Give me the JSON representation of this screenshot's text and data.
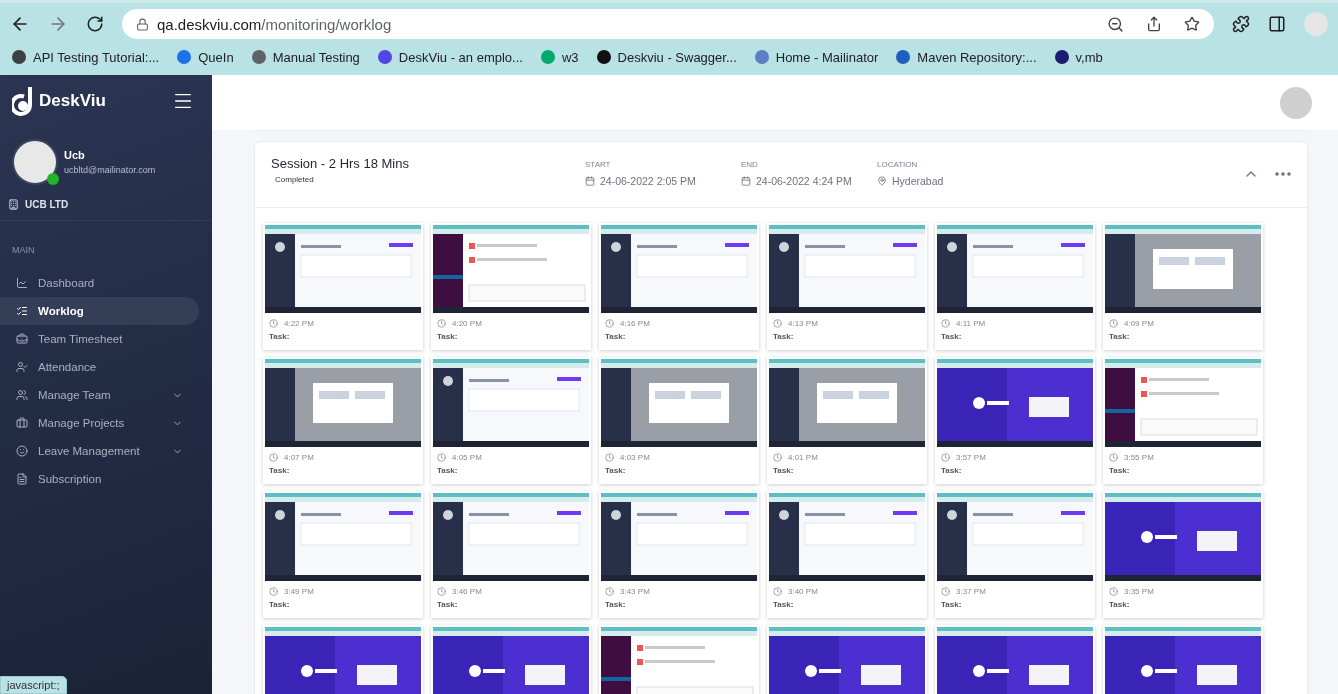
{
  "browser": {
    "url_host": "qa.deskviu.com",
    "url_path": "/monitoring/worklog",
    "bookmarks": [
      {
        "label": "API Testing Tutorial:...",
        "color": "#3c4043"
      },
      {
        "label": "QueIn",
        "color": "#1a73e8"
      },
      {
        "label": "Manual Testing",
        "color": "#5f6368"
      },
      {
        "label": "DeskViu - an emplo...",
        "color": "#4f46e5"
      },
      {
        "label": "w3",
        "color": "#04aa6d"
      },
      {
        "label": "Deskviu - Swagger...",
        "color": "#111111"
      },
      {
        "label": "Home - Mailinator",
        "color": "#5b7fc4"
      },
      {
        "label": "Maven Repository:...",
        "color": "#1f5fbf"
      },
      {
        "label": "v,mb",
        "color": "#1c1c6e"
      }
    ],
    "status_text": "javascript:;"
  },
  "sidebar": {
    "brand": "DeskViu",
    "user": {
      "name": "Ucb",
      "email": "ucbltd@mailinator.com",
      "online": true
    },
    "company": "UCB LTD",
    "section": "MAIN",
    "items": [
      {
        "label": "Dashboard",
        "selected": false,
        "expandable": false
      },
      {
        "label": "Worklog",
        "selected": true,
        "expandable": false
      },
      {
        "label": "Team Timesheet",
        "selected": false,
        "expandable": false
      },
      {
        "label": "Attendance",
        "selected": false,
        "expandable": false
      },
      {
        "label": "Manage Team",
        "selected": false,
        "expandable": true
      },
      {
        "label": "Manage Projects",
        "selected": false,
        "expandable": true
      },
      {
        "label": "Leave Management",
        "selected": false,
        "expandable": true
      },
      {
        "label": "Subscription",
        "selected": false,
        "expandable": false
      }
    ]
  },
  "session": {
    "title": "Session - 2 Hrs 18 Mins",
    "status": "Completed",
    "fields": [
      {
        "label": "START",
        "value": "24-06-2022 2:05 PM",
        "kind": "date"
      },
      {
        "label": "END",
        "value": "24-06-2022 4:24 PM",
        "kind": "date"
      },
      {
        "label": "LOCATION",
        "value": "Hyderabad",
        "kind": "place"
      }
    ],
    "expanded": true,
    "screenshots": [
      {
        "kind": "app",
        "time": "4:22 PM",
        "task": "Task:"
      },
      {
        "kind": "chat",
        "time": "4:20 PM",
        "task": "Task:"
      },
      {
        "kind": "app",
        "time": "4:16 PM",
        "task": "Task:"
      },
      {
        "kind": "app",
        "time": "4:13 PM",
        "task": "Task:"
      },
      {
        "kind": "app",
        "time": "4:11 PM",
        "task": "Task:"
      },
      {
        "kind": "dialog",
        "time": "4:09 PM",
        "task": "Task:"
      },
      {
        "kind": "dialog",
        "time": "4:07 PM",
        "task": "Task:"
      },
      {
        "kind": "app",
        "time": "4:05 PM",
        "task": "Task:"
      },
      {
        "kind": "dialog",
        "time": "4:03 PM",
        "task": "Task:"
      },
      {
        "kind": "dialog",
        "time": "4:01 PM",
        "task": "Task:"
      },
      {
        "kind": "landing",
        "time": "3:57 PM",
        "task": "Task:"
      },
      {
        "kind": "chat",
        "time": "3:55 PM",
        "task": "Task:"
      },
      {
        "kind": "app",
        "time": "3:49 PM",
        "task": "Task:"
      },
      {
        "kind": "app",
        "time": "3:46 PM",
        "task": "Task:"
      },
      {
        "kind": "app",
        "time": "3:43 PM",
        "task": "Task:"
      },
      {
        "kind": "app",
        "time": "3:40 PM",
        "task": "Task:"
      },
      {
        "kind": "app",
        "time": "3:37 PM",
        "task": "Task:"
      },
      {
        "kind": "landing",
        "time": "3:35 PM",
        "task": "Task:"
      },
      {
        "kind": "landing"
      },
      {
        "kind": "landing"
      },
      {
        "kind": "chat"
      },
      {
        "kind": "landing"
      },
      {
        "kind": "landing"
      },
      {
        "kind": "landing"
      }
    ]
  }
}
